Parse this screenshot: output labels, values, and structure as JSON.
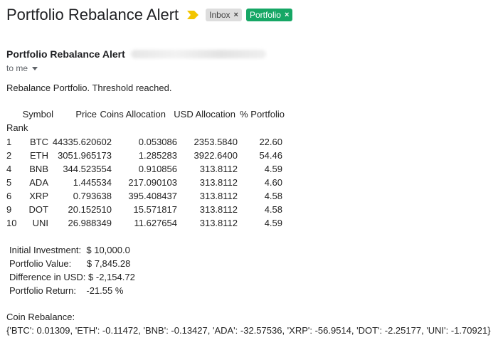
{
  "subject": "Portfolio Rebalance Alert",
  "labels": [
    "Inbox",
    "Portfolio"
  ],
  "icons": {
    "importance": "importance-marker-icon",
    "remove": "close-icon",
    "caret": "chevron-down-icon"
  },
  "sender": {
    "name": "Portfolio Rebalance Alert",
    "to": "to me"
  },
  "body": {
    "intro": "Rebalance Portfolio. Threshold reached.",
    "table": {
      "headers": [
        "Symbol",
        "Price",
        "Coins Allocation",
        "USD Allocation",
        "% Portfolio"
      ],
      "index_label": "Rank",
      "rows": [
        [
          "1",
          "BTC",
          "44335.620602",
          "0.053086",
          "2353.5840",
          "22.60"
        ],
        [
          "2",
          "ETH",
          "3051.965173",
          "1.285283",
          "3922.6400",
          "54.46"
        ],
        [
          "4",
          "BNB",
          "344.523554",
          "0.910856",
          "313.8112",
          "4.59"
        ],
        [
          "5",
          "ADA",
          "1.445534",
          "217.090103",
          "313.8112",
          "4.60"
        ],
        [
          "6",
          "XRP",
          "0.793638",
          "395.408437",
          "313.8112",
          "4.58"
        ],
        [
          "9",
          "DOT",
          "20.152510",
          "15.571817",
          "313.8112",
          "4.58"
        ],
        [
          "10",
          "UNI",
          "26.988349",
          "11.627654",
          "313.8112",
          "4.59"
        ]
      ]
    },
    "summary": [
      "Initial Investment:  $ 10,000.0",
      "Portfolio Value:      $ 7,845.28",
      "Difference in USD: $ -2,154.72",
      "Portfolio Return:    -21.55 %"
    ],
    "rebalance_title": "Coin Rebalance:",
    "rebalance_value": "{'BTC': 0.01309, 'ETH': -0.11472, 'BNB': -0.13427, 'ADA': -32.57536, 'XRP': -56.9514, 'DOT': -2.25177, 'UNI': -1.70921}"
  },
  "colors": {
    "portfolio_label": "#16a765",
    "importance": "#f2c500"
  }
}
